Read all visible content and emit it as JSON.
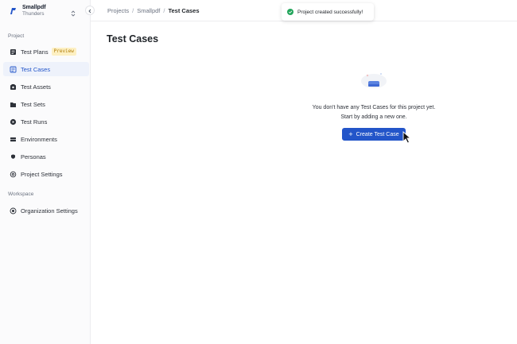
{
  "workspace": {
    "name": "Smallpdf",
    "subtitle": "Thunders"
  },
  "sidebar": {
    "project_label": "Project",
    "items": [
      {
        "label": "Test Plans",
        "icon": "test-plans-icon",
        "badge": "Preview",
        "active": false
      },
      {
        "label": "Test Cases",
        "icon": "test-cases-icon",
        "active": true
      },
      {
        "label": "Test Assets",
        "icon": "test-assets-icon",
        "active": false
      },
      {
        "label": "Test Sets",
        "icon": "folder-icon",
        "active": false
      },
      {
        "label": "Test Runs",
        "icon": "play-icon",
        "active": false
      },
      {
        "label": "Environments",
        "icon": "server-icon",
        "active": false
      },
      {
        "label": "Personas",
        "icon": "persona-icon",
        "active": false
      },
      {
        "label": "Project Settings",
        "icon": "gear-icon",
        "active": false
      }
    ],
    "workspace_label": "Workspace",
    "workspace_items": [
      {
        "label": "Organization Settings",
        "icon": "org-settings-icon"
      }
    ]
  },
  "breadcrumb": {
    "items": [
      "Projects",
      "Smallpdf",
      "Test Cases"
    ],
    "separator": "/"
  },
  "page": {
    "title": "Test Cases"
  },
  "toast": {
    "message": "Project created successfully!",
    "status_color": "#22a55b"
  },
  "empty_state": {
    "line1": "You don't have any Test Cases for this project yet.",
    "line2": "Start by adding a new one.",
    "button_label": "Create Test Case"
  },
  "colors": {
    "accent": "#2355c9",
    "badge_bg": "#fdf0c3",
    "badge_text": "#b07c0a"
  }
}
